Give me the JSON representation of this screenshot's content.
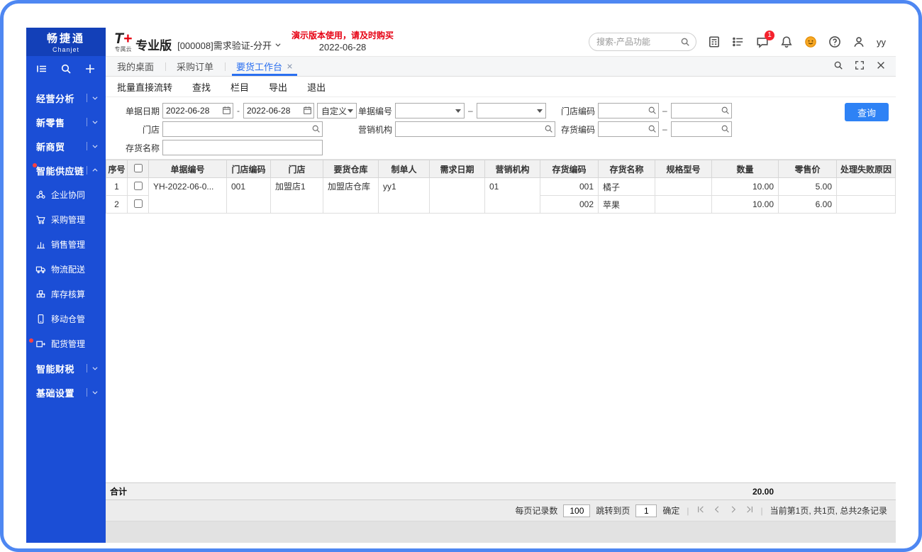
{
  "colors": {
    "frame": "#4e87f2",
    "sidebar_blue": "#1b4ed6",
    "accent_blue": "#2e82f5",
    "active_tab_blue": "#2a6ff0",
    "demo_red": "#e60012"
  },
  "sidebar": {
    "logo": {
      "cn": "畅捷通",
      "en": "Chanjet"
    },
    "groups": [
      {
        "label": "经营分析"
      },
      {
        "label": "新零售"
      },
      {
        "label": "新商贸"
      },
      {
        "label": "智能供应链",
        "expanded": true,
        "badge": true,
        "children": [
          {
            "label": "企业协同"
          },
          {
            "label": "采购管理"
          },
          {
            "label": "销售管理"
          },
          {
            "label": "物流配送"
          },
          {
            "label": "库存核算"
          },
          {
            "label": "移动仓管"
          },
          {
            "label": "配货管理",
            "badge": true
          }
        ]
      },
      {
        "label": "智能财税"
      },
      {
        "label": "基础设置"
      }
    ]
  },
  "header": {
    "brand_t": "T",
    "brand_plus": "+",
    "brand_cloud": "专属云",
    "edition": "专业版",
    "account": "[000008]需求验证-分开",
    "demo_notice": "演示版本使用，请及时购买",
    "date": "2022-06-28",
    "search_placeholder": "搜索-产品功能",
    "message_badge": "1",
    "username": "yy"
  },
  "tabs": {
    "items": [
      {
        "label": "我的桌面"
      },
      {
        "label": "采购订单"
      },
      {
        "label": "要货工作台",
        "active": true,
        "closable": true
      }
    ]
  },
  "toolbar": {
    "items": [
      "批量直接流转",
      "查找",
      "栏目",
      "导出",
      "退出"
    ]
  },
  "filters": {
    "date_label": "单据日期",
    "date_from": "2022-06-28",
    "date_to": "2022-06-28",
    "date_mode": "自定义",
    "doc_no_label": "单据编号",
    "store_code_label": "门店编码",
    "store_label": "门店",
    "marketing_label": "营销机构",
    "item_code_label": "存货编码",
    "item_name_label": "存货名称",
    "query_button": "查询"
  },
  "table": {
    "columns": [
      "序号",
      "",
      "单据编号",
      "门店编码",
      "门店",
      "要货仓库",
      "制单人",
      "需求日期",
      "营销机构",
      "存货编码",
      "存货名称",
      "规格型号",
      "数量",
      "零售价",
      "处理失败原因"
    ],
    "rows": [
      {
        "seq": "1",
        "doc_no": "YH-2022-06-0...",
        "store_code": "001",
        "store": "加盟店1",
        "warehouse": "加盟店仓库",
        "creator": "yy1",
        "demand_date": "",
        "marketing_org": "01",
        "item_code": "001",
        "item_name": "橘子",
        "spec": "",
        "qty": "10.00",
        "retail_price": "5.00",
        "fail_reason": ""
      },
      {
        "seq": "2",
        "item_code": "002",
        "item_name": "苹果",
        "spec": "",
        "qty": "10.00",
        "retail_price": "6.00",
        "fail_reason": ""
      }
    ]
  },
  "totals": {
    "label": "合计",
    "qty_total": "20.00"
  },
  "pagination": {
    "page_size_label": "每页记录数",
    "page_size": "100",
    "goto_label": "跳转到页",
    "goto_value": "1",
    "confirm": "确定",
    "summary": "当前第1页, 共1页, 总共2条记录"
  }
}
